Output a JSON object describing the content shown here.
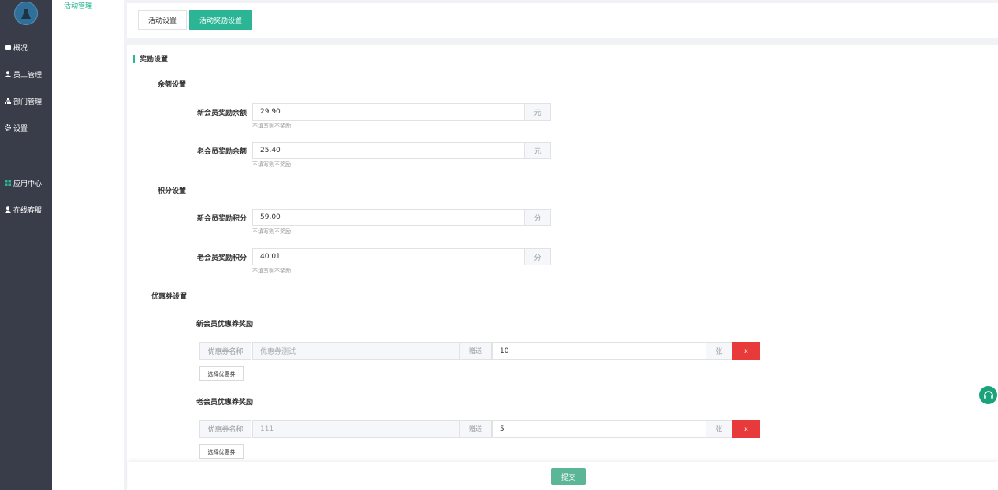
{
  "sidebar": {
    "items": [
      {
        "label": "概况",
        "icon": "overview-icon"
      },
      {
        "label": "员工管理",
        "icon": "user-icon"
      },
      {
        "label": "部门管理",
        "icon": "department-icon"
      },
      {
        "label": "设置",
        "icon": "gear-icon"
      },
      {
        "label": "应用中心",
        "icon": "grid-icon"
      },
      {
        "label": "在线客服",
        "icon": "user-icon"
      }
    ]
  },
  "subsidebar": {
    "active_item": "活动管理"
  },
  "tabs": [
    {
      "label": "活动设置",
      "active": false
    },
    {
      "label": "活动奖励设置",
      "active": true
    }
  ],
  "reward": {
    "section_title": "奖励设置",
    "balance": {
      "group_label": "余额设置",
      "new_member": {
        "label": "新会员奖励余额",
        "value": "29.90",
        "unit": "元",
        "hint": "不填写则不奖励"
      },
      "old_member": {
        "label": "老会员奖励余额",
        "value": "25.40",
        "unit": "元",
        "hint": "不填写则不奖励"
      }
    },
    "points": {
      "group_label": "积分设置",
      "new_member": {
        "label": "新会员奖励积分",
        "value": "59.00",
        "unit": "分",
        "hint": "不填写则不奖励"
      },
      "old_member": {
        "label": "老会员奖励积分",
        "value": "40.01",
        "unit": "分",
        "hint": "不填写则不奖励"
      }
    },
    "coupon": {
      "group_label": "优惠券设置",
      "new_member": {
        "title": "新会员优惠券奖励",
        "name_label": "优惠券名称",
        "name_value": "优惠券测试",
        "gift_label": "赠送",
        "qty": "10",
        "unit": "张",
        "delete_label": "x",
        "select_label": "选择优惠券"
      },
      "old_member": {
        "title": "老会员优惠券奖励",
        "name_label": "优惠券名称",
        "name_value": "111",
        "gift_label": "赠送",
        "qty": "5",
        "unit": "张",
        "delete_label": "x",
        "select_label": "选择优惠券"
      }
    }
  },
  "footer": {
    "submit_label": "提交"
  },
  "colors": {
    "accent": "#2bb595",
    "sidebar_bg": "#393d49",
    "danger": "#e83a3a"
  }
}
